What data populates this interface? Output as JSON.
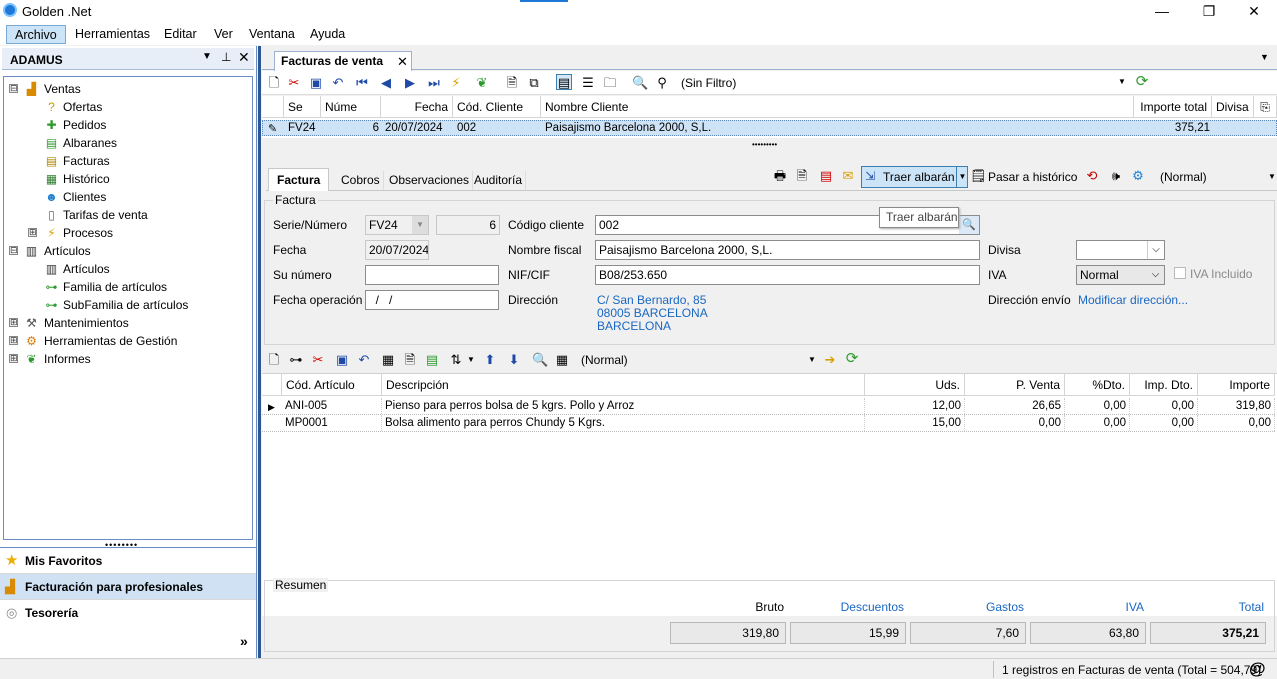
{
  "window": {
    "title": "Golden .Net",
    "minimize": "—",
    "maximize": "❐",
    "close": "✕"
  },
  "menu": [
    "Archivo",
    "Herramientas",
    "Editar",
    "Ver",
    "Ventana",
    "Ayuda"
  ],
  "left_panel": {
    "title": "ADAMUS",
    "tree": [
      {
        "label": "Ventas",
        "level": 0,
        "exp": "⊟",
        "icon": "chart-icon"
      },
      {
        "label": "Ofertas",
        "level": 1,
        "icon": "question-icon"
      },
      {
        "label": "Pedidos",
        "level": 1,
        "icon": "plus-icon"
      },
      {
        "label": "Albaranes",
        "level": 1,
        "icon": "document-icon"
      },
      {
        "label": "Facturas",
        "level": 1,
        "icon": "invoice-icon"
      },
      {
        "label": "Histórico",
        "level": 1,
        "icon": "history-icon"
      },
      {
        "label": "Clientes",
        "level": 1,
        "icon": "clients-icon"
      },
      {
        "label": "Tarifas de venta",
        "level": 1,
        "icon": "page-icon"
      },
      {
        "label": "Procesos",
        "level": 1,
        "exp": "⊞",
        "icon": "lightning-icon"
      },
      {
        "label": "Artículos",
        "level": 0,
        "exp": "⊟",
        "icon": "barcode-icon"
      },
      {
        "label": "Artículos",
        "level": 1,
        "icon": "barcode-icon"
      },
      {
        "label": "Familia de artículos",
        "level": 1,
        "icon": "hierarchy-icon"
      },
      {
        "label": "SubFamilia de artículos",
        "level": 1,
        "icon": "hierarchy-icon"
      },
      {
        "label": "Mantenimientos",
        "level": 0,
        "exp": "⊞",
        "icon": "tools-icon"
      },
      {
        "label": "Herramientas de Gestión",
        "level": 0,
        "exp": "⊞",
        "icon": "gear-icon"
      },
      {
        "label": "Informes",
        "level": 0,
        "exp": "⊞",
        "icon": "leaf-icon"
      }
    ],
    "favorites": [
      "Mis Favoritos",
      "Facturación para profesionales",
      "Tesorería"
    ],
    "more": "»"
  },
  "doc_tab": {
    "label": "Facturas de venta",
    "close": "✕"
  },
  "filter": "(Sin Filtro)",
  "top_grid": {
    "columns": [
      "Se",
      "Núme",
      "Fecha",
      "Cód. Cliente",
      "Nombre Cliente",
      "Importe total",
      "Divisa"
    ],
    "rows": [
      [
        "FV24",
        "6",
        "20/07/2024",
        "002",
        "Paisajismo Barcelona 2000, S,L.",
        "375,21",
        ""
      ]
    ]
  },
  "form_tabs": [
    "Factura",
    "Cobros",
    "Observaciones",
    "Auditoría"
  ],
  "actions": {
    "traer": "Traer albarán",
    "pasar": "Pasar a histórico",
    "view": "(Normal)",
    "tooltip": "Traer albarán"
  },
  "factura": {
    "group": "Factura",
    "serie_label": "Serie/Número",
    "serie": "FV24",
    "numero": "6",
    "codigo_label": "Código cliente",
    "codigo": "002",
    "fecha_label": "Fecha",
    "fecha": "20/07/2024",
    "nombre_label": "Nombre fiscal",
    "nombre": "Paisajismo Barcelona 2000, S,L.",
    "divisa_label": "Divisa",
    "divisa": "",
    "sunum_label": "Su número",
    "sunum": "",
    "nif_label": "NIF/CIF",
    "nif": "B08/253.650",
    "iva_label": "IVA",
    "iva": "Normal",
    "iva_incl": "IVA Incluido",
    "fop_label": "Fecha operación",
    "fop": "  /   /",
    "dir_label": "Dirección",
    "dir1": "C/ San Bernardo, 85",
    "dir2": "08005 BARCELONA",
    "dir3": "BARCELONA",
    "envio_label": "Dirección envío",
    "envio": "Modificar dirección..."
  },
  "lines_view": "(Normal)",
  "lines_grid": {
    "columns": [
      "Cód. Artículo",
      "Descripción",
      "Uds.",
      "P. Venta",
      "%Dto.",
      "Imp. Dto.",
      "Importe"
    ],
    "rows": [
      [
        "ANI-005",
        "Pienso para perros bolsa de 5 kgrs. Pollo y Arroz",
        "12,00",
        "26,65",
        "0,00",
        "0,00",
        "319,80"
      ],
      [
        "MP0001",
        "Bolsa alimento para perros Chundy 5 Kgrs.",
        "15,00",
        "0,00",
        "0,00",
        "0,00",
        "0,00"
      ]
    ]
  },
  "resumen": {
    "title": "Resumen",
    "labels": [
      "Bruto",
      "Descuentos",
      "Gastos",
      "IVA",
      "Total"
    ],
    "values": [
      "319,80",
      "15,99",
      "7,60",
      "63,80",
      "375,21"
    ]
  },
  "status": "1 registros en Facturas de venta (Total = 504,79)",
  "status_icon": "@"
}
